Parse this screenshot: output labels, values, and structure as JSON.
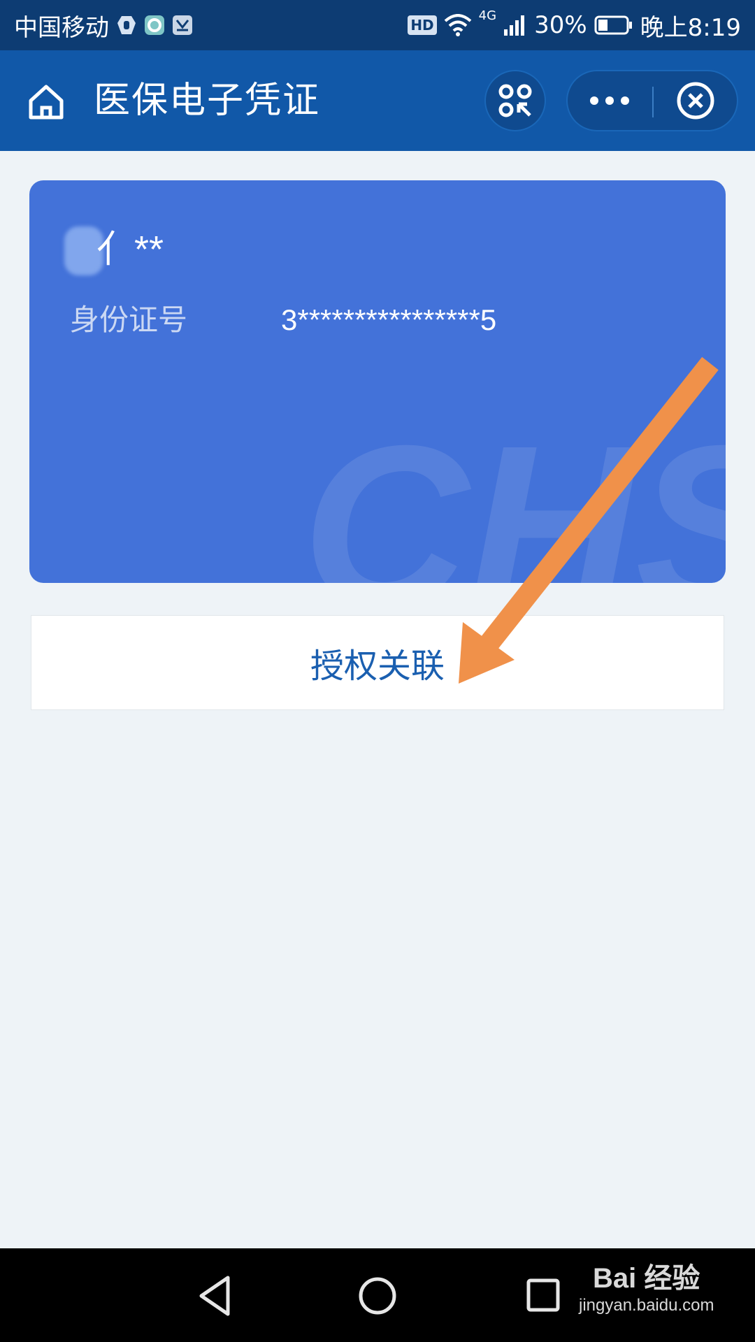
{
  "status_bar": {
    "carrier": "中国移动",
    "hd_badge": "HD",
    "network": "4G",
    "battery_percent": "30%",
    "time": "晚上8:19",
    "icons": [
      "hand-icon",
      "app-o-icon",
      "huawei-app-icon",
      "wifi-icon",
      "signal-icon",
      "battery-icon"
    ]
  },
  "header": {
    "title": "医保电子凭证",
    "icons": [
      "home-icon",
      "scan-icon",
      "more-icon",
      "close-icon"
    ]
  },
  "card": {
    "name": "*",
    "id_label": "身份证号",
    "id_value": "3****************5",
    "watermark": "CHS",
    "background_color": "#4372d9"
  },
  "actions": {
    "authorize_label": "授权关联"
  },
  "annotation": {
    "arrow_color": "#f0914a"
  },
  "nav_bar": {
    "icons": [
      "back-icon",
      "home-circle-icon",
      "recent-apps-icon"
    ]
  },
  "watermark_brand": {
    "logo_text": "Bai 经验",
    "url": "jingyan.baidu.com"
  },
  "colors": {
    "status_bar": "#0d3c73",
    "header": "#1158a8",
    "page_background": "#eef3f7",
    "link_blue": "#1a5fb0"
  }
}
